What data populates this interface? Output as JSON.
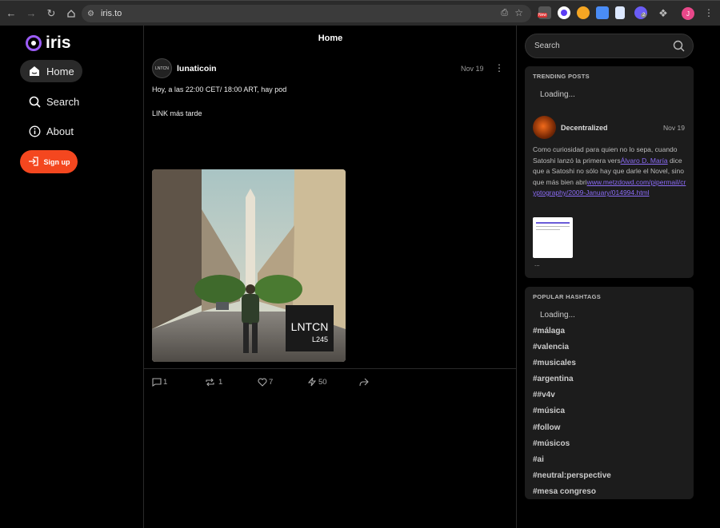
{
  "browser": {
    "url": "iris.to",
    "new_badge": "New",
    "ext_count": "2",
    "profile_initial": "J"
  },
  "sidebar": {
    "logo_text": "iris",
    "items": [
      {
        "label": "Home",
        "icon": "home-icon"
      },
      {
        "label": "Search",
        "icon": "search-icon"
      },
      {
        "label": "About",
        "icon": "info-icon"
      }
    ],
    "signup_label": "Sign up"
  },
  "feed": {
    "title": "Home",
    "post": {
      "avatar_text": "LNTCN",
      "author": "lunaticoin",
      "date": "Nov 19",
      "text_line1": "Hoy, a las 22:00 CET/ 18:00 ART, hay pod",
      "text_line2": "LINK más tarde",
      "image_sign_title": "LNTCN",
      "image_sign_sub": "L245",
      "replies": "1",
      "reposts": "1",
      "likes": "7",
      "zaps": "50"
    }
  },
  "right": {
    "search_placeholder": "Search",
    "trending": {
      "title": "TRENDING POSTS",
      "loading": "Loading...",
      "author": "Decentralized",
      "date": "Nov 19",
      "text_a": "Como curiosidad para quien no lo sepa, cuando Satoshi lanzó la primera vers",
      "link_a": "Álvaro D. María",
      "text_b": " dice que a Satoshi no sólo hay que darle el Novel, sino que más bien abri",
      "link_b": "www.metzdowd.com/pipermail/cryptography/2009-January/014994.html",
      "more": "..."
    },
    "hashtags": {
      "title": "POPULAR HASHTAGS",
      "loading": "Loading...",
      "items": [
        "#málaga",
        "#valencia",
        "#musicales",
        "#argentina",
        "##v4v",
        "#música",
        "#follow",
        "#músicos",
        "#ai",
        "#neutral:perspective",
        "#mesa congreso"
      ]
    }
  },
  "colors": {
    "accent": "#9b5cf6",
    "signup": "#f4471f",
    "link": "#8b6cf6"
  }
}
